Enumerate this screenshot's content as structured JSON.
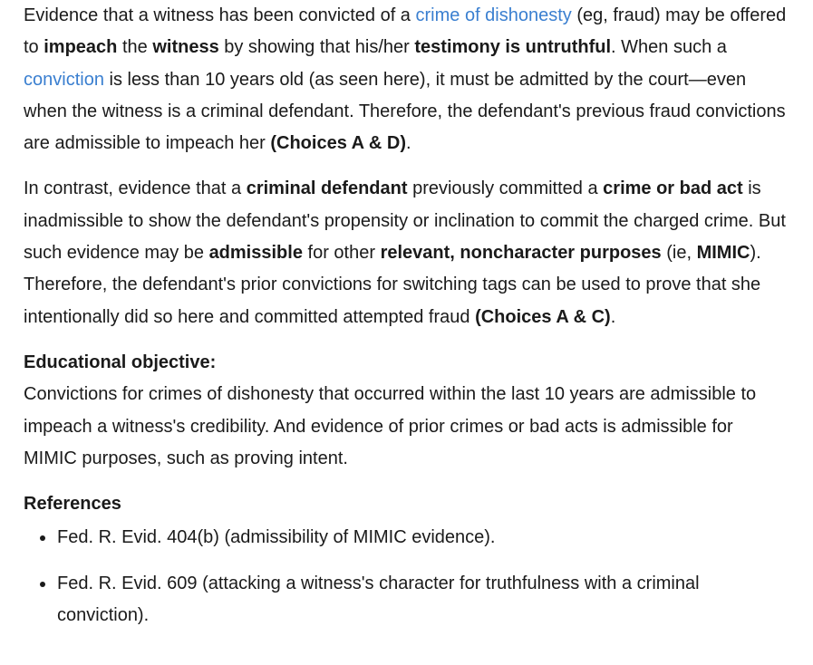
{
  "p1": {
    "t1": "Evidence that a witness has been convicted of a ",
    "link1": "crime of dishonesty",
    "t2": " (eg, fraud) may be offered to ",
    "b1": "impeach",
    "t3": " the ",
    "b2": "witness",
    "t4": " by showing that his/her ",
    "b3": "testimony is untruthful",
    "t5": ".  When such a ",
    "link2": "conviction",
    "t6": " is less than 10 years old (as seen here), it must be admitted by the court—even when the witness is a criminal defendant.  Therefore, the defendant's previous fraud convictions are admissible to impeach her ",
    "b4": "(Choices A & D)",
    "t7": "."
  },
  "p2": {
    "t1": "In contrast, evidence that a ",
    "b1": "criminal defendant",
    "t2": " previously committed a ",
    "b2": "crime or bad act",
    "t3": " is inadmissible to show the defendant's propensity or inclination to commit the charged crime.  But such evidence may be ",
    "b3": "admissible",
    "t4": " for other ",
    "b4": "relevant, noncharacter purposes",
    "t5": " (ie, ",
    "b5": "MIMIC",
    "t6": ").  Therefore, the defendant's prior convictions for switching tags can be used to prove that she intentionally did so here and committed attempted fraud ",
    "b6": "(Choices A & C)",
    "t7": "."
  },
  "objective": {
    "heading": "Educational objective:",
    "text": "Convictions for crimes of dishonesty that occurred within the last 10 years are admissible to impeach a witness's credibility.  And evidence of prior crimes or bad acts is admissible for MIMIC purposes, such as proving intent."
  },
  "references": {
    "heading": "References",
    "items": [
      "Fed. R. Evid. 404(b) (admissibility of MIMIC evidence).",
      "Fed. R. Evid. 609 (attacking a witness's character for truthfulness with a criminal conviction)."
    ]
  }
}
